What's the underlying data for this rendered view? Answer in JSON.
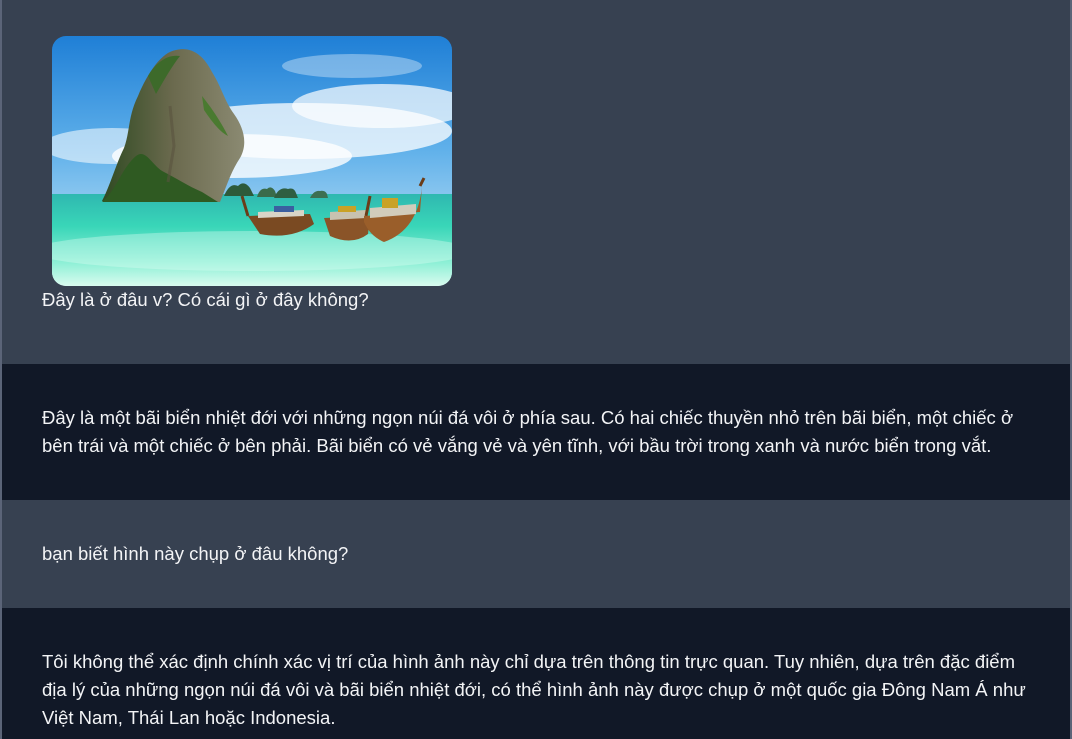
{
  "conversation": {
    "messages": [
      {
        "role": "user",
        "image": {
          "icon": "beach-photo"
        },
        "text": "Đây là ở đâu v? Có cái gì ở đây không?"
      },
      {
        "role": "assistant",
        "text": "Đây là một bãi biển nhiệt đới với những ngọn núi đá vôi ở phía sau. Có hai chiếc thuyền nhỏ trên bãi biển, một chiếc ở bên trái và một chiếc ở bên phải. Bãi biển có vẻ vắng vẻ và yên tĩnh, với bầu trời trong xanh và nước biển trong vắt."
      },
      {
        "role": "user",
        "text": "bạn biết hình này chụp ở đâu không?"
      },
      {
        "role": "assistant",
        "text": "Tôi không thể xác định chính xác vị trí của hình ảnh này chỉ dựa trên thông tin trực quan. Tuy nhiên, dựa trên đặc điểm địa lý của những ngọn núi đá vôi và bãi biển nhiệt đới, có thể hình ảnh này được chụp ở một quốc gia Đông Nam Á như Việt Nam, Thái Lan hoặc Indonesia."
      }
    ]
  },
  "colors": {
    "user_bg": "#374151",
    "assistant_bg": "#111827",
    "text": "#f3f4f6"
  }
}
